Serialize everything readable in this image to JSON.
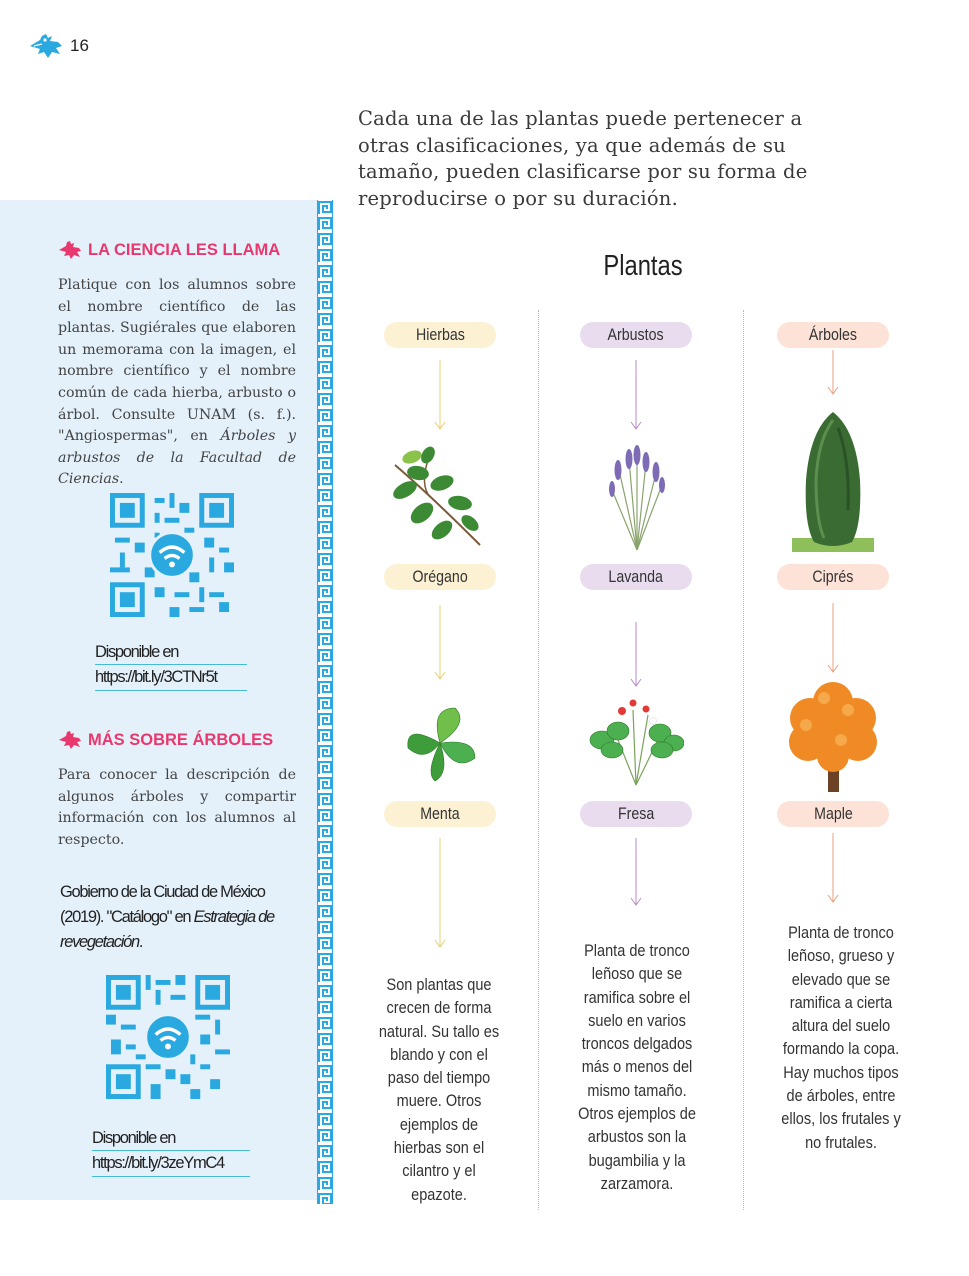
{
  "header": {
    "page_number": "16"
  },
  "intro": {
    "text": "Cada una de las plantas puede pertenecer a otras clasificaciones, ya que además de su tamaño, pueden clasificarse por su forma de reproducirse o por su duración."
  },
  "sidebar": {
    "section1": {
      "heading": "LA CIENCIA LES LLAMA",
      "text_main": "Platique con los alumnos sobre el nombre científico de las plantas. Sugiérales que elaboren un memorama con la imagen, el nombre científico y el nombre común de cada hierba, arbusto o árbol.  Consulte UNAM (s. f.). \"Angiospermas\", en ",
      "text_italic": "Árboles y arbustos de la Facultad de Ciencias",
      "text_end": ".",
      "available_label": "Disponible en",
      "link": "https://bit.ly/3CTNr5t"
    },
    "section2": {
      "heading": "MÁS SOBRE ÁRBOLES",
      "text": "Para conocer la descripción de algunos árboles y compartir información con los alumnos al respecto.",
      "reference_main": "Gobierno de la Ciudad de México (2019). \"Catálogo\" en ",
      "reference_italic": "Estrategia de revegetación",
      "reference_end": ".",
      "available_label": "Disponible en",
      "link": "https://bit.ly/3zeYmC4"
    }
  },
  "diagram": {
    "title": "Plantas",
    "columns": [
      {
        "category": "Hierbas",
        "examples": [
          "Orégano",
          "Menta"
        ],
        "description": "Son plantas que crecen de forma natural. Su tallo es blando y con el paso del tiempo muere. Otros ejemplos de hierbas son el cilantro y el epazote."
      },
      {
        "category": "Arbustos",
        "examples": [
          "Lavanda",
          "Fresa"
        ],
        "description": "Planta de tronco leñoso que se ramifica sobre el suelo en varios troncos delgados más o menos del mismo tamaño. Otros ejemplos de arbustos son la bugambilia y la zarzamora."
      },
      {
        "category": "Árboles",
        "examples": [
          "Ciprés",
          "Maple"
        ],
        "description": "Planta de tronco leñoso, grueso y elevado que se ramifica a cierta altura del suelo formando la copa. Hay muchos tipos de árboles, entre ellos, los frutales y no frutales."
      }
    ]
  },
  "colors": {
    "accent_pink": "#e8386e",
    "accent_blue": "#29a9df",
    "sidebar_bg": "#e4f1fb",
    "arrow_yellow": "#e8d070",
    "arrow_purple": "#b98bc8",
    "arrow_orange": "#eba07f"
  }
}
